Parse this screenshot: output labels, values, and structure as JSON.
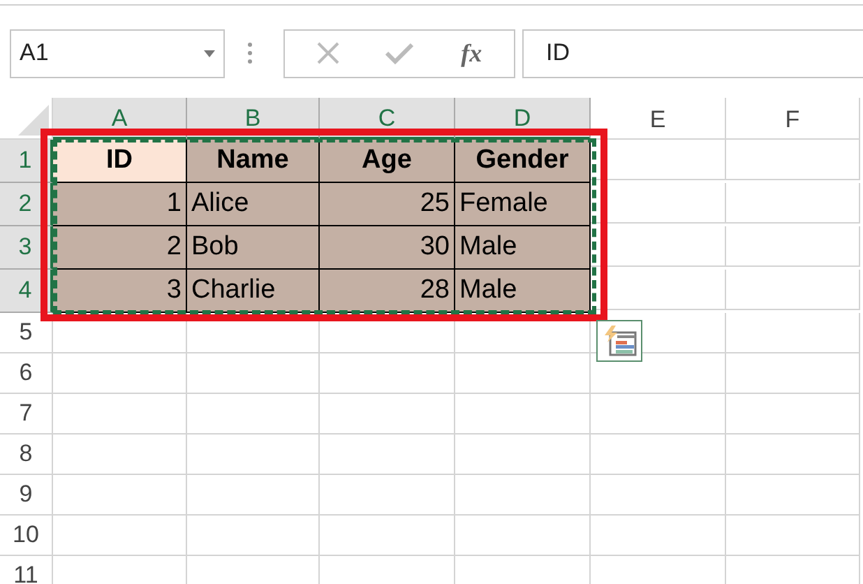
{
  "name_box": {
    "value": "A1"
  },
  "formula_bar": {
    "function_label": "fx",
    "value": "ID"
  },
  "columns": [
    {
      "label": "A",
      "selected": true
    },
    {
      "label": "B",
      "selected": true
    },
    {
      "label": "C",
      "selected": true
    },
    {
      "label": "D",
      "selected": true
    },
    {
      "label": "E",
      "selected": false
    },
    {
      "label": "F",
      "selected": false
    }
  ],
  "rows": [
    {
      "label": "1",
      "selected": true,
      "cells": [
        {
          "text": "ID",
          "kind": "header",
          "active": true
        },
        {
          "text": "Name",
          "kind": "header",
          "active": false
        },
        {
          "text": "Age",
          "kind": "header",
          "active": false
        },
        {
          "text": "Gender",
          "kind": "header",
          "active": false
        }
      ]
    },
    {
      "label": "2",
      "selected": true,
      "cells": [
        {
          "text": "1",
          "kind": "number",
          "active": false
        },
        {
          "text": "Alice",
          "kind": "text",
          "active": false
        },
        {
          "text": "25",
          "kind": "number",
          "active": false
        },
        {
          "text": "Female",
          "kind": "text",
          "active": false
        }
      ]
    },
    {
      "label": "3",
      "selected": true,
      "cells": [
        {
          "text": "2",
          "kind": "number",
          "active": false
        },
        {
          "text": "Bob",
          "kind": "text",
          "active": false
        },
        {
          "text": "30",
          "kind": "number",
          "active": false
        },
        {
          "text": "Male",
          "kind": "text",
          "active": false
        }
      ]
    },
    {
      "label": "4",
      "selected": true,
      "cells": [
        {
          "text": "3",
          "kind": "number",
          "active": false
        },
        {
          "text": "Charlie",
          "kind": "text",
          "active": false
        },
        {
          "text": "28",
          "kind": "number",
          "active": false
        },
        {
          "text": "Male",
          "kind": "text",
          "active": false
        }
      ]
    },
    {
      "label": "5",
      "selected": false
    },
    {
      "label": "6",
      "selected": false
    },
    {
      "label": "7",
      "selected": false
    },
    {
      "label": "8",
      "selected": false
    },
    {
      "label": "9",
      "selected": false
    },
    {
      "label": "10",
      "selected": false
    },
    {
      "label": "11",
      "selected": false
    }
  ]
}
